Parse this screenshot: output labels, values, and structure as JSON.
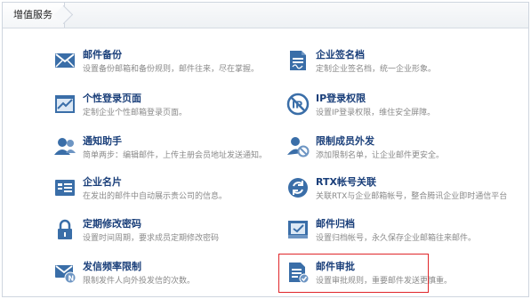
{
  "tab": {
    "label": "增值服务"
  },
  "services": [
    {
      "title": "邮件备份",
      "desc": "设置备份邮箱和备份规则，邮件往来，尽在掌握。",
      "icon": "mail-envelope-icon"
    },
    {
      "title": "企业签名档",
      "desc": "定制企业签名档，统一企业形象。",
      "icon": "signature-icon"
    },
    {
      "title": "个性登录页面",
      "desc": "定制企业个性邮箱登录页面。",
      "icon": "login-page-icon"
    },
    {
      "title": "IP登录权限",
      "desc": "设置IP登录权限，维住安全屏障。",
      "icon": "ip-restriction-icon"
    },
    {
      "title": "通知助手",
      "desc": "简单两步：编辑邮件，上传主册会员地址发送通知。",
      "icon": "notification-users-icon"
    },
    {
      "title": "限制成员外发",
      "desc": "添加限制名单，让企业邮件更安全。",
      "icon": "restrict-member-icon"
    },
    {
      "title": "企业名片",
      "desc": "在发出的邮件中自动展示贵公司的信息。",
      "icon": "business-card-icon"
    },
    {
      "title": "RTX帐号关联",
      "desc": "关联RTX与企业邮箱帐号，整合腾讯企业即时通信平台",
      "icon": "rtx-link-icon"
    },
    {
      "title": "定期修改密码",
      "desc": "设置时间周期，要求成员定期修改密码",
      "icon": "padlock-icon"
    },
    {
      "title": "邮件归档",
      "desc": "设置归档帐号，永久保存企业邮箱往来邮件。",
      "icon": "archive-icon"
    },
    {
      "title": "发信频率限制",
      "desc": "限制发件人向外投发信的次数。",
      "icon": "send-frequency-icon"
    },
    {
      "title": "邮件审批",
      "desc": "设置审批规则，重要邮件发送更慎重。",
      "icon": "mail-approval-icon"
    }
  ],
  "colors": {
    "title": "#1a3f7a",
    "icon": "#3a6ea8",
    "highlight": "#e0262a"
  }
}
